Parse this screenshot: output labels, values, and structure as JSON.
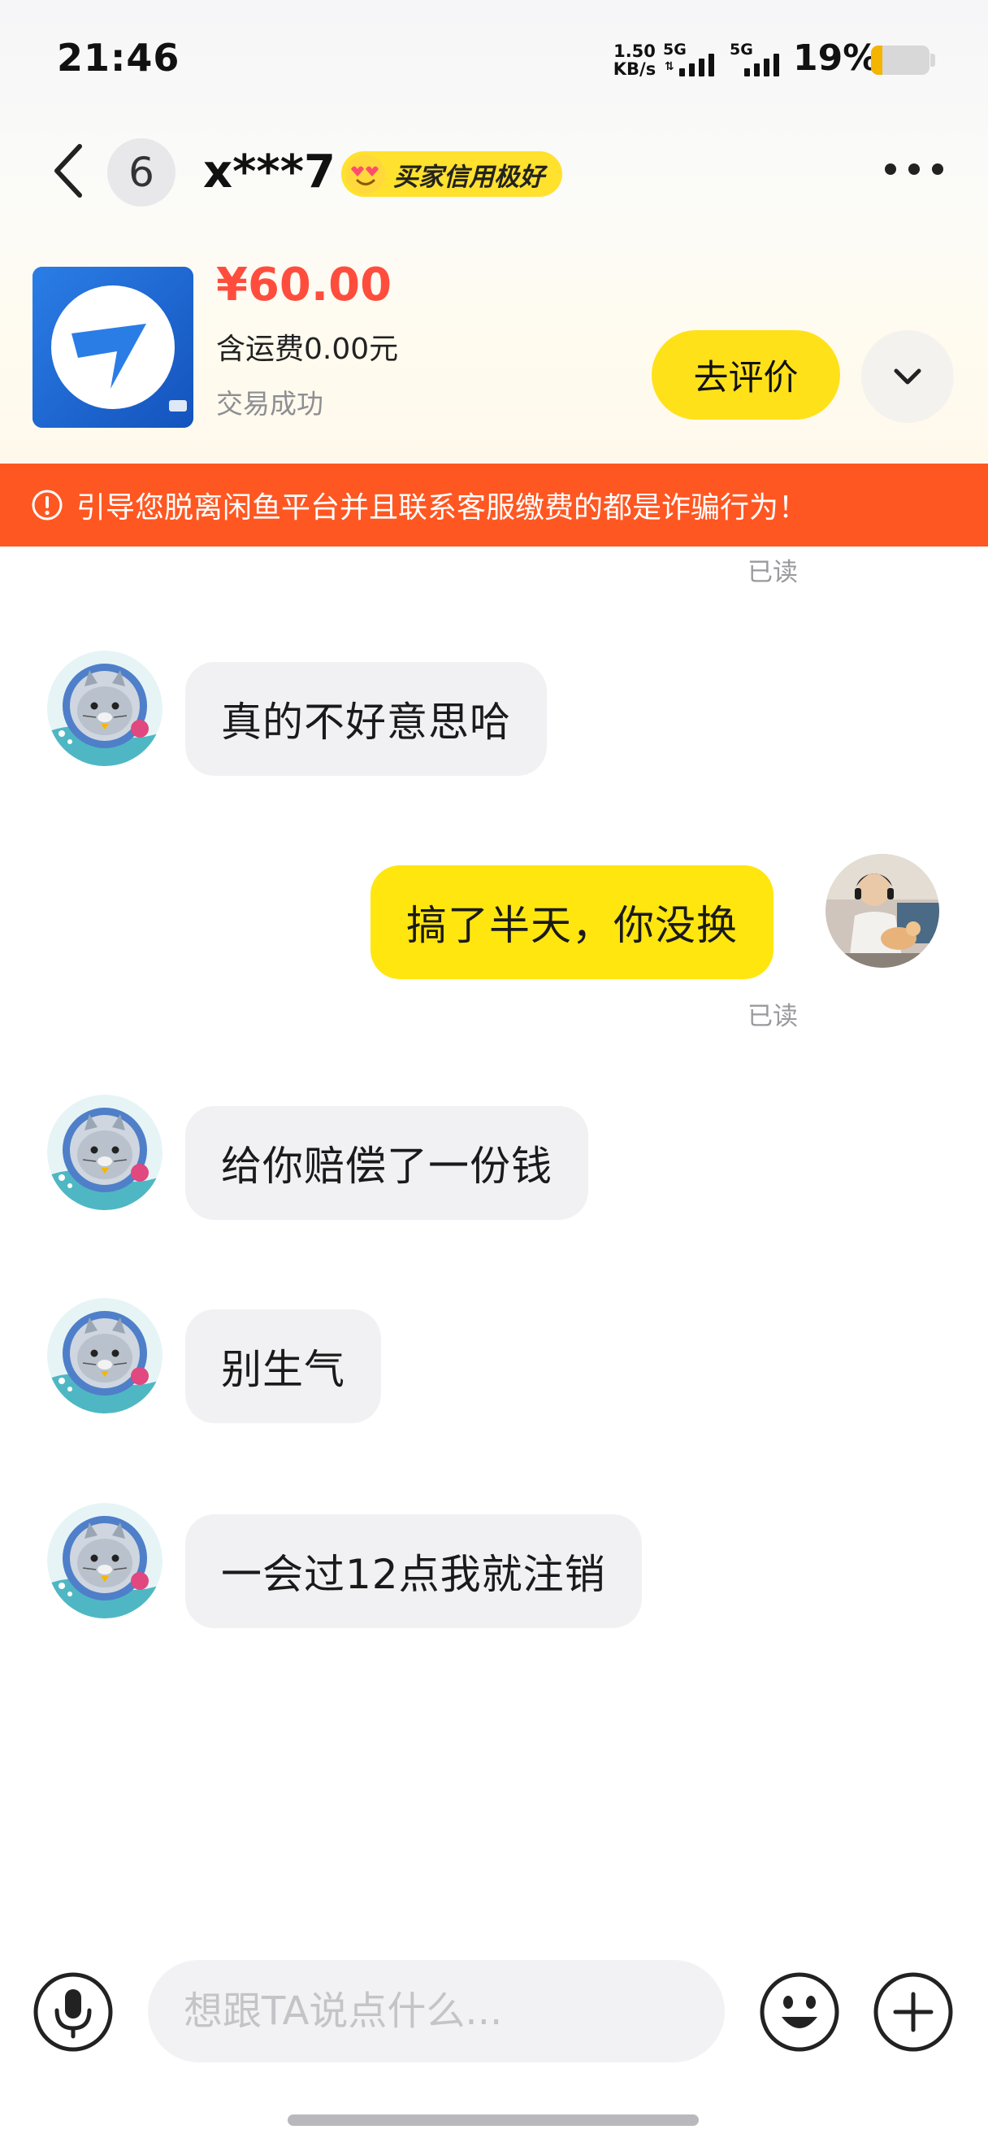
{
  "status_bar": {
    "time": "21:46",
    "net_speed_value": "1.50",
    "net_speed_unit": "KB/s",
    "signal_1_label": "5G",
    "signal_2_label": "5G",
    "battery_percent": "19%",
    "battery_level": 0.19,
    "battery_color": "#f4b400"
  },
  "header": {
    "back_icon": "chevron-left-icon",
    "unread_count": "6",
    "title": "x***7",
    "credit_badge": "买家信用极好",
    "credit_badge_color": "#ffe12e",
    "more_icon": "more-horizontal-icon"
  },
  "product": {
    "price": "¥60.00",
    "price_color": "#ff4d3d",
    "shipping": "含运费0.00元",
    "status": "交易成功",
    "review_button": "去评价",
    "expand_icon": "chevron-down-icon"
  },
  "warning": {
    "icon": "alert-circle-icon",
    "text": "引导您脱离闲鱼平台并且联系客服缴费的都是诈骗行为！",
    "color": "#ff5722"
  },
  "messages": [
    {
      "from": "them",
      "text": "真的不好意思哈"
    },
    {
      "from": "me",
      "text": "搞了半天，你没换"
    },
    {
      "from": "them",
      "text": "给你赔偿了一份钱"
    },
    {
      "from": "them",
      "text": "别生气"
    },
    {
      "from": "them",
      "text": "一会过12点我就注销"
    }
  ],
  "read_receipts": [
    "已读",
    "已读"
  ],
  "input_bar": {
    "voice_icon": "microphone-icon",
    "placeholder": "想跟TA说点什么...",
    "value": "",
    "emoji_icon": "smile-icon",
    "plus_icon": "plus-circle-icon"
  },
  "colors": {
    "my_bubble": "#ffe60f",
    "their_bubble": "#f1f1f3",
    "accent_yellow": "#ffe11a"
  }
}
